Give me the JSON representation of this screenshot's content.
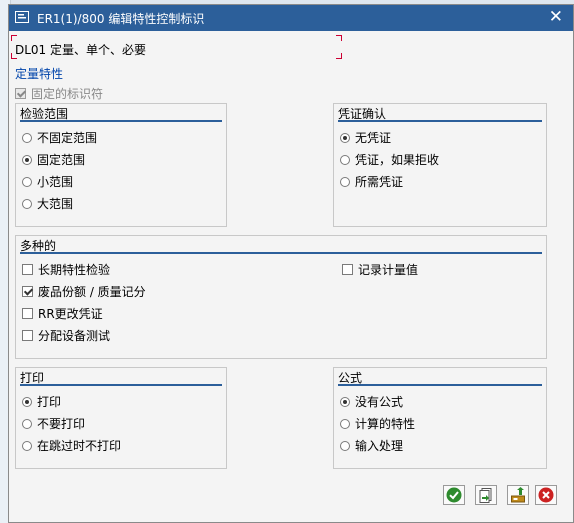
{
  "dialog": {
    "title": "ER1(1)/800 编辑特性控制标识",
    "header": "DL01 定量、单个、必要",
    "section_link": "定量特性",
    "fixed_indicator": {
      "label": "固定的标识符",
      "checked": true,
      "disabled": true
    }
  },
  "inspection_scope": {
    "title": "检验范围",
    "options": [
      {
        "label": "不固定范围",
        "selected": false
      },
      {
        "label": "固定范围",
        "selected": true
      },
      {
        "label": "小范围",
        "selected": false
      },
      {
        "label": "大范围",
        "selected": false
      }
    ]
  },
  "certificate": {
    "title": "凭证确认",
    "options": [
      {
        "label": "无凭证",
        "selected": true
      },
      {
        "label": "凭证，如果拒收",
        "selected": false
      },
      {
        "label": "所需凭证",
        "selected": false
      }
    ]
  },
  "misc": {
    "title": "多种的",
    "left": [
      {
        "label": "长期特性检验",
        "checked": false
      },
      {
        "label": "废品份额 / 质量记分",
        "checked": true
      },
      {
        "label": "RR更改凭证",
        "checked": false
      },
      {
        "label": "分配设备测试",
        "checked": false
      }
    ],
    "right": [
      {
        "label": "记录计量值",
        "checked": false
      }
    ]
  },
  "print": {
    "title": "打印",
    "options": [
      {
        "label": "打印",
        "selected": true
      },
      {
        "label": "不要打印",
        "selected": false
      },
      {
        "label": "在跳过时不打印",
        "selected": false
      }
    ]
  },
  "formula": {
    "title": "公式",
    "options": [
      {
        "label": "没有公式",
        "selected": true
      },
      {
        "label": "计算的特性",
        "selected": false
      },
      {
        "label": "输入处理",
        "selected": false
      }
    ]
  },
  "buttons": [
    {
      "icon": "confirm-check-icon",
      "color": "#2e8b2e"
    },
    {
      "icon": "copy-icon",
      "color": "#2e8b2e"
    },
    {
      "icon": "transfer-icon",
      "color": "#c08a1a"
    },
    {
      "icon": "cancel-x-icon",
      "color": "#cc2222"
    }
  ],
  "colors": {
    "titlebar": "#2c5f9a",
    "accent_line": "#2c5f9a",
    "link": "#0044aa",
    "bracket": "#cc0033"
  }
}
